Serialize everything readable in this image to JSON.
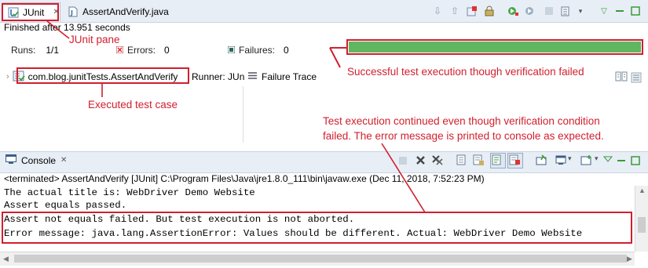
{
  "junit": {
    "tabs": [
      {
        "label": "JUnit",
        "close": "✕"
      },
      {
        "label": "AssertAndVerify.java"
      }
    ],
    "status": "Finished after 13.951 seconds",
    "runs_label": "Runs:",
    "runs_value": "1/1",
    "errors_label": "Errors:",
    "errors_value": "0",
    "failures_label": "Failures:",
    "failures_value": "0",
    "progress": 1.0,
    "progress_color": "#5fb760",
    "test_case": "com.blog.junitTests.AssertAndVerify",
    "runner_label": "Runner: JUn",
    "failure_trace_label": "Failure Trace",
    "toolbar_icons": [
      "next-failure-icon",
      "previous-failure-icon",
      "show-failures-only-icon",
      "scroll-lock-icon",
      "rerun-icon",
      "rerun-failed-first-icon",
      "stop-icon",
      "history-icon",
      "view-menu-icon",
      "minimize-icon",
      "maximize-icon"
    ]
  },
  "console": {
    "tab_label": "Console",
    "tab_close": "✕",
    "terminated": "<terminated> AssertAndVerify [JUnit] C:\\Program Files\\Java\\jre1.8.0_111\\bin\\javaw.exe (Dec 11, 2018, 7:52:23 PM)",
    "lines": [
      "The actual title is: WebDriver Demo Website",
      "Assert equals passed.",
      "Assert not equals failed. But test execution is not aborted.",
      "Error message: java.lang.AssertionError: Values should be different. Actual: WebDriver Demo Website"
    ]
  },
  "annotations": {
    "junit_pane": "JUnit pane",
    "success": "Successful test execution though verification failed",
    "executed": "Executed test case",
    "console_note_1": "Test execution continued even though verification condition",
    "console_note_2": "failed. The error message is printed to console as expected.",
    "color": "#d11f2e"
  }
}
